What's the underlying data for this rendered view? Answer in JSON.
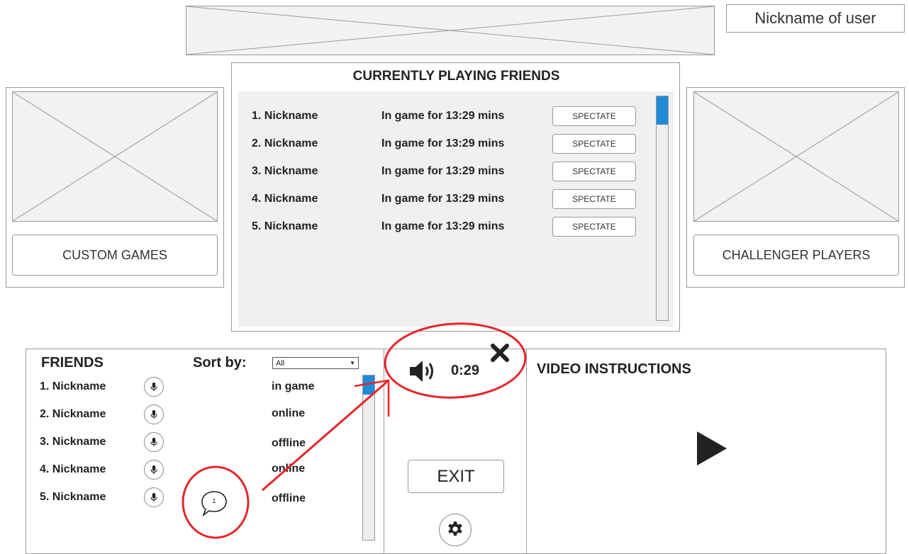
{
  "header": {
    "nickname": "Nickname of user"
  },
  "playing": {
    "title": "CURRENTLY PLAYING FRIENDS",
    "rows": [
      {
        "name": "1. Nickname",
        "status": "In game for 13:29 mins",
        "action": "SPECTATE"
      },
      {
        "name": "2. Nickname",
        "status": "In game for 13:29 mins",
        "action": "SPECTATE"
      },
      {
        "name": "3. Nickname",
        "status": "In game for 13:29 mins",
        "action": "SPECTATE"
      },
      {
        "name": "4. Nickname",
        "status": "In game for 13:29 mins",
        "action": "SPECTATE"
      },
      {
        "name": "5. Nickname",
        "status": "In game for 13:29 mins",
        "action": "SPECTATE"
      }
    ]
  },
  "left_card": {
    "button": "CUSTOM GAMES"
  },
  "right_card": {
    "button": "CHALLENGER PLAYERS"
  },
  "friends": {
    "title": "FRIENDS",
    "sort_label": "Sort by:",
    "sort_value": "All",
    "rows": [
      {
        "name": "1. Nickname",
        "status": "in game"
      },
      {
        "name": "2. Nickname",
        "status": "online"
      },
      {
        "name": "3. Nickname",
        "status": "offline"
      },
      {
        "name": "4. Nickname",
        "status": "online"
      },
      {
        "name": "5. Nickname",
        "status": "offline"
      }
    ],
    "chat_count": "1"
  },
  "controls": {
    "timer": "0:29",
    "exit": "EXIT"
  },
  "video": {
    "title": "VIDEO INSTRUCTIONS"
  },
  "icons": [
    "speaker-icon",
    "close-icon",
    "play-icon",
    "gear-icon",
    "mic-icon",
    "chat-bubble-icon"
  ],
  "colors": {
    "annotation": "#e8252b",
    "scroll_thumb": "#1f8ad6",
    "placeholder": "#f2f2f2"
  }
}
